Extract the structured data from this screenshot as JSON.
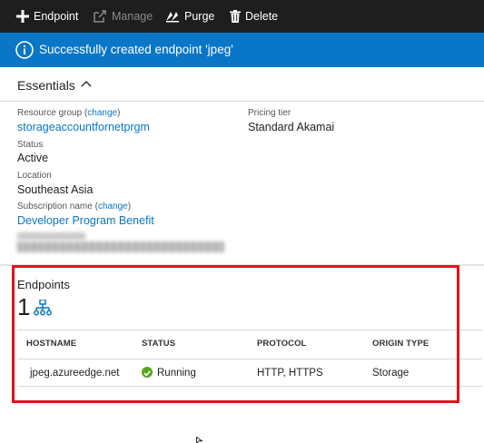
{
  "toolbar": {
    "endpoint_label": "Endpoint",
    "manage_label": "Manage",
    "purge_label": "Purge",
    "delete_label": "Delete"
  },
  "notification": {
    "message": "Successfully created endpoint 'jpeg'",
    "icon": "info-icon",
    "color": "#0a76c7"
  },
  "essentials": {
    "title": "Essentials",
    "resource_group": {
      "label": "Resource group",
      "change": "change",
      "value": "storageaccountfornetprgm"
    },
    "status": {
      "label": "Status",
      "value": "Active"
    },
    "location": {
      "label": "Location",
      "value": "Southeast Asia"
    },
    "subscription": {
      "label": "Subscription name",
      "change": "change",
      "value": "Developer Program Benefit"
    },
    "pricing_tier": {
      "label": "Pricing tier",
      "value": "Standard Akamai"
    }
  },
  "endpoints": {
    "title": "Endpoints",
    "count": "1",
    "columns": [
      "HOSTNAME",
      "STATUS",
      "PROTOCOL",
      "ORIGIN TYPE"
    ],
    "rows": [
      {
        "hostname": "jpeg.azureedge.net",
        "status": "Running",
        "protocol": "HTTP, HTTPS",
        "origin_type": "Storage"
      }
    ]
  },
  "colors": {
    "accent": "#0a76c7",
    "status_running": "#5aa520",
    "highlight": "#e3121b"
  }
}
